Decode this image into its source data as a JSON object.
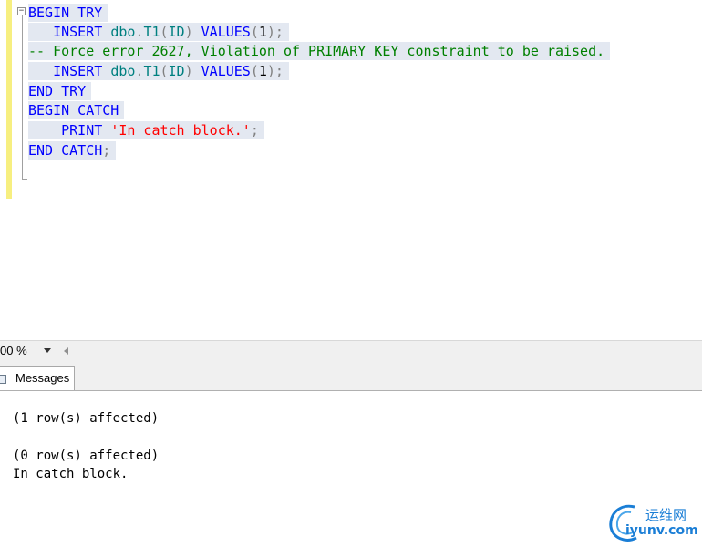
{
  "editor": {
    "lines": [
      {
        "indent": "",
        "segments": [
          {
            "k": "kw",
            "t": "BEGIN TRY"
          }
        ]
      },
      {
        "indent": "   ",
        "segments": [
          {
            "k": "kw",
            "t": "INSERT "
          },
          {
            "k": "id",
            "t": "dbo"
          },
          {
            "k": "gr",
            "t": "."
          },
          {
            "k": "id",
            "t": "T1"
          },
          {
            "k": "gr",
            "t": "("
          },
          {
            "k": "id",
            "t": "ID"
          },
          {
            "k": "gr",
            "t": ") "
          },
          {
            "k": "kw",
            "t": "VALUES"
          },
          {
            "k": "gr",
            "t": "("
          },
          {
            "k": "nm",
            "t": "1"
          },
          {
            "k": "gr",
            "t": ");"
          }
        ]
      },
      {
        "indent": "",
        "segments": [
          {
            "k": "cm",
            "t": "-- Force error 2627, Violation of PRIMARY KEY constraint to be raised."
          }
        ]
      },
      {
        "indent": "   ",
        "segments": [
          {
            "k": "kw",
            "t": "INSERT "
          },
          {
            "k": "id",
            "t": "dbo"
          },
          {
            "k": "gr",
            "t": "."
          },
          {
            "k": "id",
            "t": "T1"
          },
          {
            "k": "gr",
            "t": "("
          },
          {
            "k": "id",
            "t": "ID"
          },
          {
            "k": "gr",
            "t": ") "
          },
          {
            "k": "kw",
            "t": "VALUES"
          },
          {
            "k": "gr",
            "t": "("
          },
          {
            "k": "nm",
            "t": "1"
          },
          {
            "k": "gr",
            "t": ");"
          }
        ]
      },
      {
        "indent": "",
        "segments": [
          {
            "k": "kw",
            "t": "END TRY"
          }
        ]
      },
      {
        "indent": "",
        "segments": [
          {
            "k": "kw",
            "t": "BEGIN CATCH"
          }
        ]
      },
      {
        "indent": "    ",
        "segments": [
          {
            "k": "kw",
            "t": "PRINT "
          },
          {
            "k": "st",
            "t": "'In catch block.'"
          },
          {
            "k": "gr",
            "t": ";"
          }
        ]
      },
      {
        "indent": "",
        "segments": [
          {
            "k": "kw",
            "t": "END CATCH"
          },
          {
            "k": "gr",
            "t": ";"
          }
        ]
      }
    ],
    "fold_symbol": "−"
  },
  "zoom": {
    "value": "00 %"
  },
  "results": {
    "tabs": [
      {
        "label": "Messages",
        "active": true
      }
    ],
    "messages": [
      "(1 row(s) affected)",
      "",
      "(0 row(s) affected)",
      "In catch block."
    ]
  },
  "watermark": {
    "cn_text": "运维网",
    "url": "iyunv.com"
  }
}
